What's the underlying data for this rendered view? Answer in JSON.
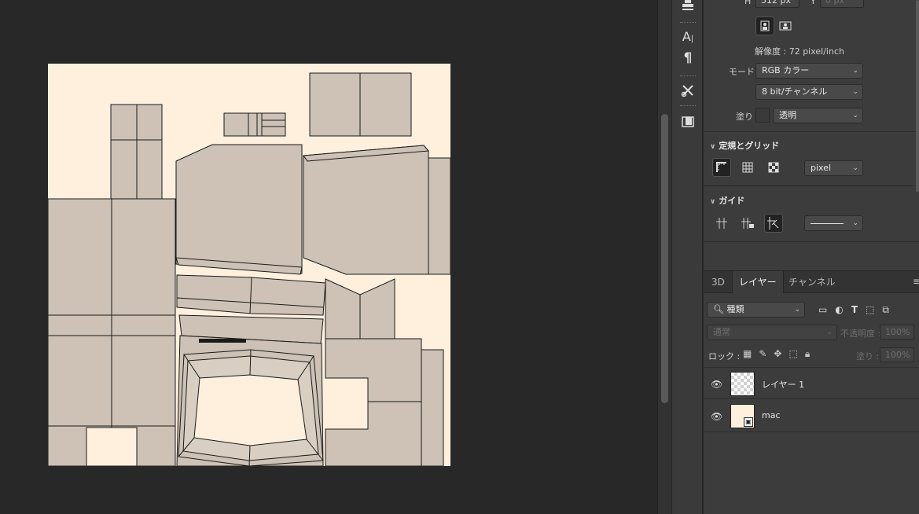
{
  "properties": {
    "height_label": "H",
    "height_value": "512 px",
    "y_label": "Y",
    "y_value": "0 px",
    "resolution": "解像度 : 72 pixel/inch",
    "mode_label": "モード",
    "mode_value": "RGB カラー",
    "bit_value": "8 bit/チャンネル",
    "fill_label": "塗り",
    "fill_value": "透明",
    "section_rulers": "定規とグリッド",
    "units_value": "pixel",
    "section_guides": "ガイド"
  },
  "layers_panel": {
    "tabs": [
      "3D",
      "レイヤー",
      "チャンネル"
    ],
    "active_tab": "レイヤー",
    "filter_value": "種類",
    "blend_mode": "通常",
    "opacity_label": "不透明度 :",
    "opacity_value": "100%",
    "lock_label": "ロック :",
    "fill_label": "塗り :",
    "fill_value": "100%",
    "layers": [
      {
        "name": "レイヤー 1",
        "visible": true,
        "thumbnail": "transparent"
      },
      {
        "name": "mac",
        "visible": true,
        "thumbnail": "smart-object"
      }
    ]
  },
  "icons": {
    "tools": [
      "stamp-icon",
      "character-icon",
      "paragraph-icon",
      "tool-presets-icon",
      "libraries-icon"
    ],
    "orientation": [
      "portrait-icon",
      "landscape-icon"
    ],
    "rulers": [
      "ruler-icon",
      "grid-icon",
      "transparency-grid-icon"
    ],
    "guides": [
      "guides-icon",
      "lock-guides-icon",
      "smart-guides-icon"
    ]
  },
  "colors": {
    "canvas_bg": "#fff0de",
    "uv_fill": "#cdc2b5",
    "uv_stroke": "#1a1a1a",
    "workspace": "#282828",
    "panel": "#3c3c3c"
  }
}
